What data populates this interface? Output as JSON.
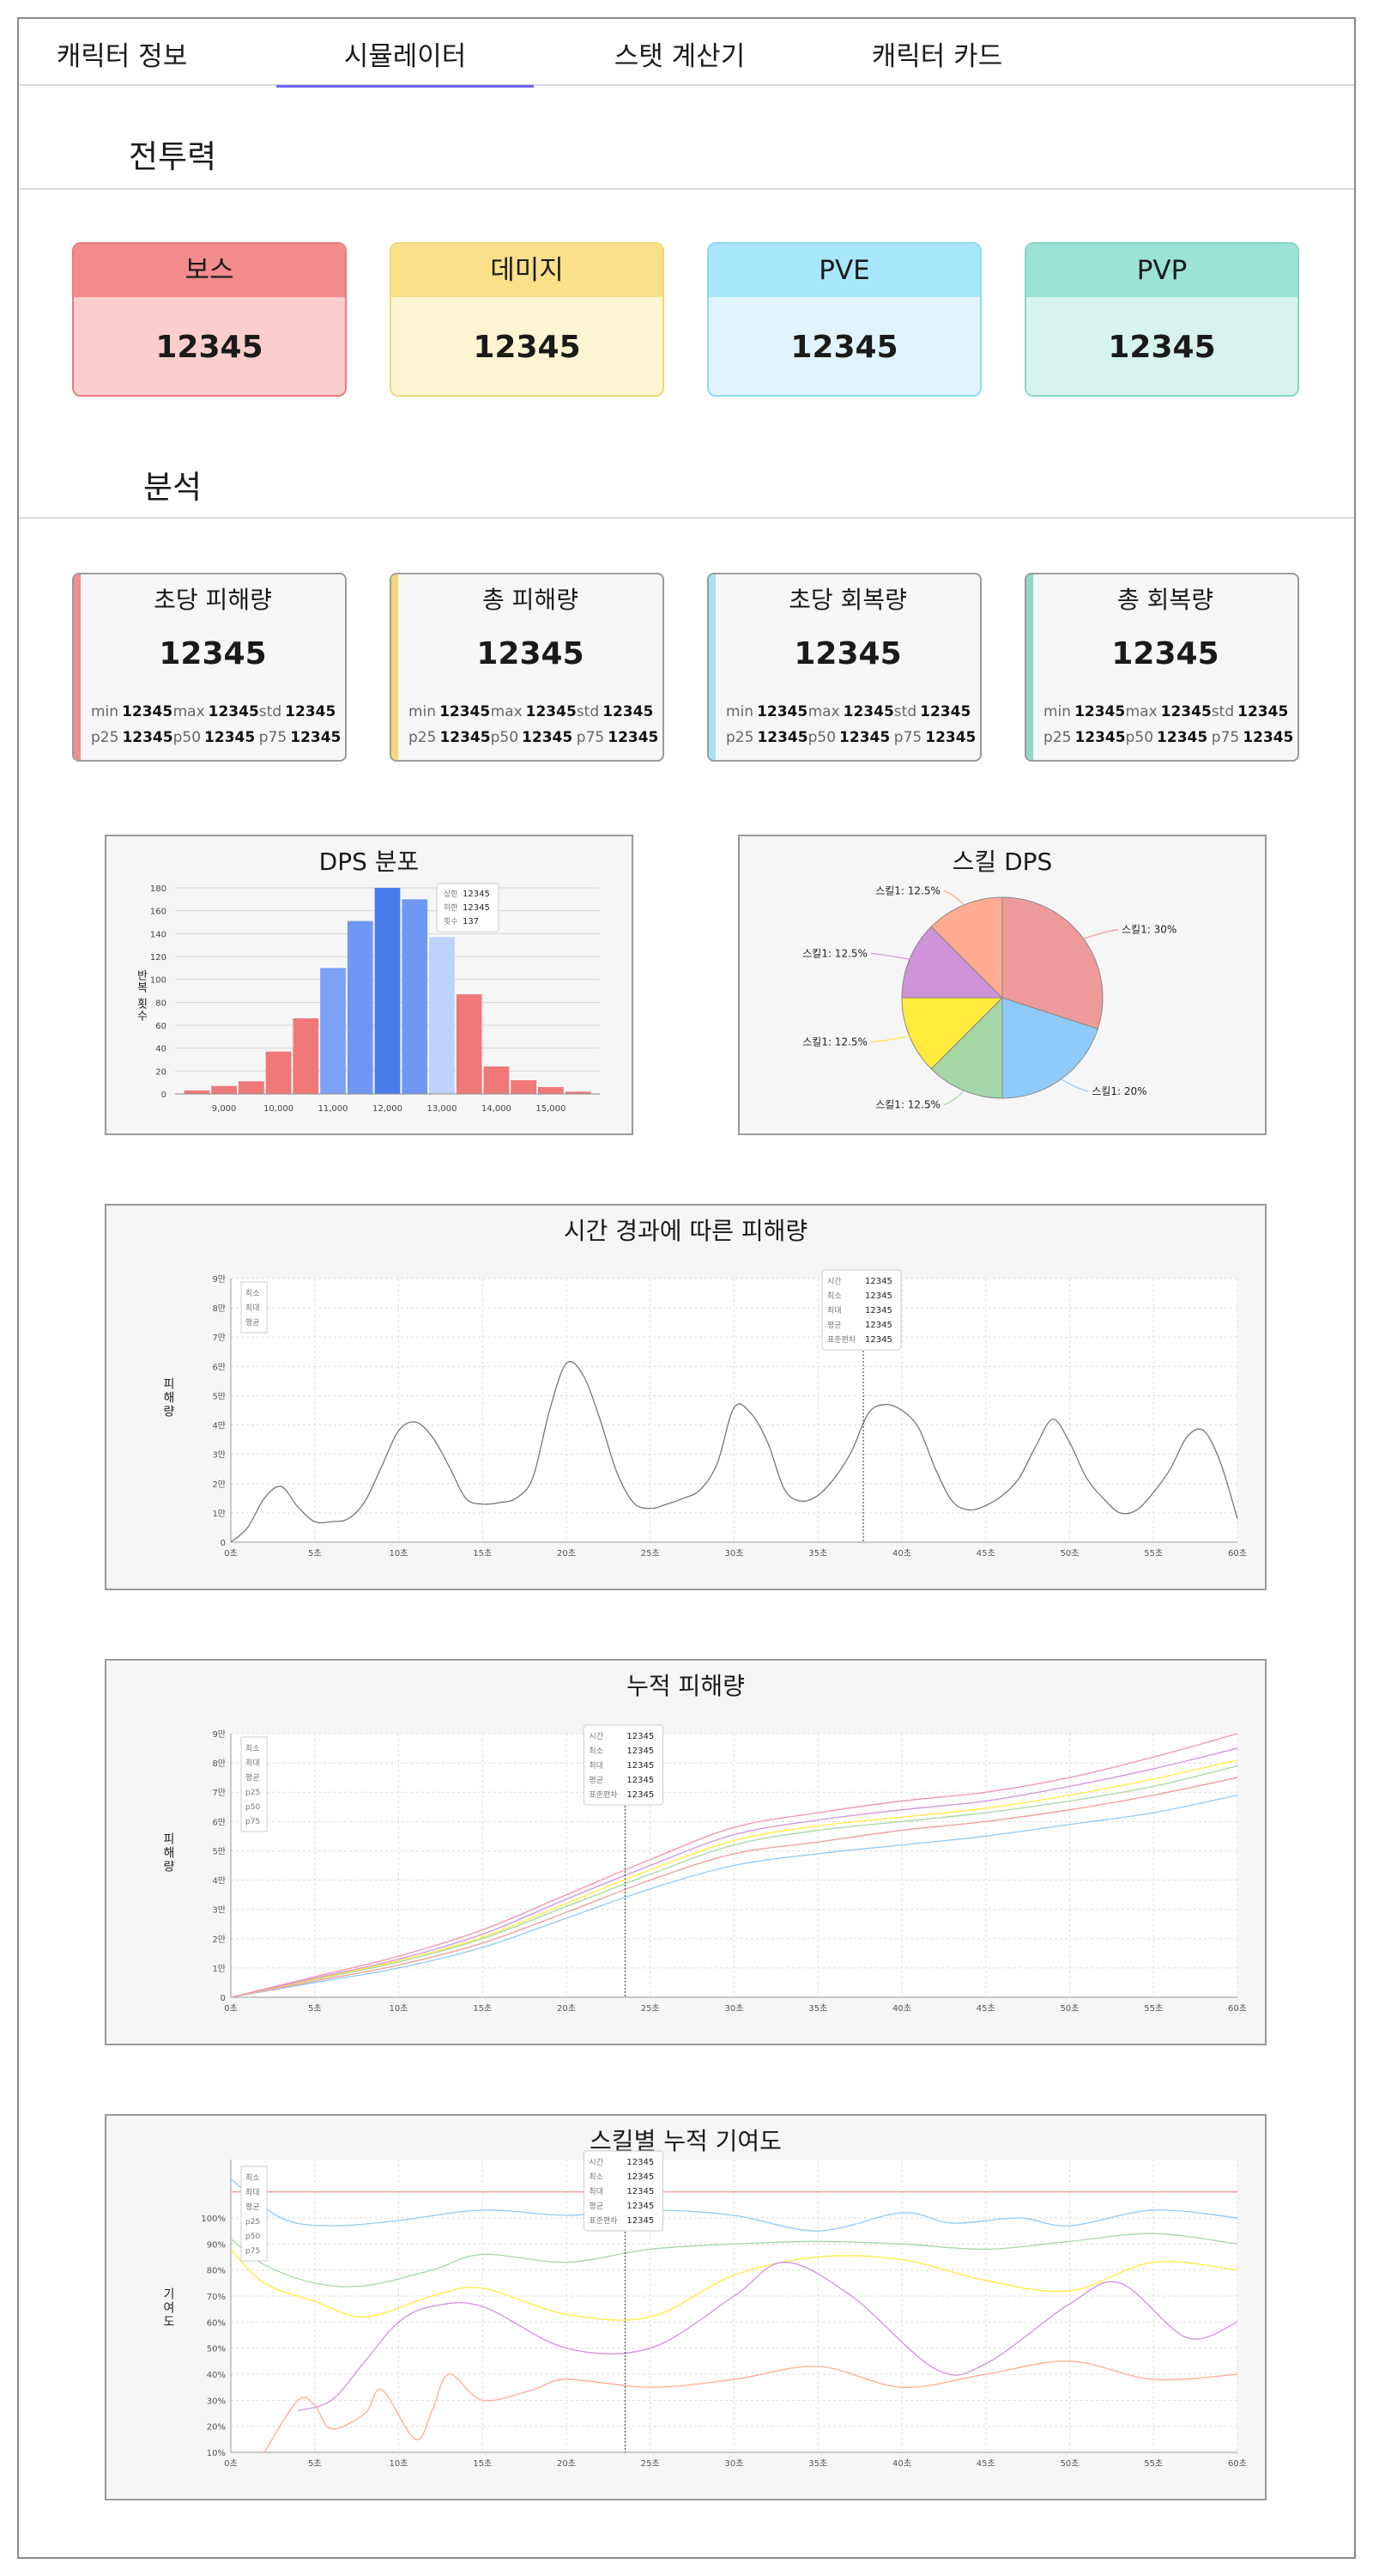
{
  "tabs": [
    {
      "label": "캐릭터 정보"
    },
    {
      "label": "시뮬레이터"
    },
    {
      "label": "스탯 계산기"
    },
    {
      "label": "캐릭터 카드"
    }
  ],
  "sections": {
    "power": "전투력",
    "analysis": "분석"
  },
  "power_cards": [
    {
      "label": "보스",
      "value": "12345",
      "head": "#f28b8b",
      "body": "#facece",
      "border": "#e87a7a"
    },
    {
      "label": "데미지",
      "value": "12345",
      "head": "#fbe08a",
      "body": "#fdf4d2",
      "border": "#f2d674"
    },
    {
      "label": "PVE",
      "value": "12345",
      "head": "#a8e6fb",
      "body": "#dff4fc",
      "border": "#8fd9f2"
    },
    {
      "label": "PVP",
      "value": "12345",
      "head": "#9ae3d5",
      "body": "#d6f3ed",
      "border": "#86d6c6"
    }
  ],
  "stat_cards": [
    {
      "title": "초당 피해량",
      "value": "12345",
      "accent": "#f08e8e",
      "min": "12345",
      "max": "12345",
      "std": "12345",
      "p25": "12345",
      "p50": "12345",
      "p75": "12345"
    },
    {
      "title": "총 피해량",
      "value": "12345",
      "accent": "#f6d879",
      "min": "12345",
      "max": "12345",
      "std": "12345",
      "p25": "12345",
      "p50": "12345",
      "p75": "12345"
    },
    {
      "title": "초당 회복량",
      "value": "12345",
      "accent": "#a8e0f6",
      "min": "12345",
      "max": "12345",
      "std": "12345",
      "p25": "12345",
      "p50": "12345",
      "p75": "12345"
    },
    {
      "title": "총 회복량",
      "value": "12345",
      "accent": "#8fd8c7",
      "min": "12345",
      "max": "12345",
      "std": "12345",
      "p25": "12345",
      "p50": "12345",
      "p75": "12345"
    }
  ],
  "stat_labels": {
    "min": "min",
    "max": "max",
    "std": "std",
    "p25": "p25",
    "p50": "p50",
    "p75": "p75"
  },
  "chart_data": [
    {
      "type": "bar",
      "title": "DPS 분포",
      "ylabel": "반복 횟수",
      "ylim": [
        0,
        180
      ],
      "yticks": [
        0,
        20,
        40,
        60,
        80,
        100,
        120,
        140,
        160,
        180
      ],
      "xticks": [
        "9,000",
        "10,000",
        "11,000",
        "12,000",
        "13,000",
        "14,000",
        "15,000"
      ],
      "bins": [
        {
          "x0": 8250,
          "x1": 8750,
          "value": 3,
          "color": "#f07878"
        },
        {
          "x0": 8750,
          "x1": 9250,
          "value": 7,
          "color": "#f07878"
        },
        {
          "x0": 9250,
          "x1": 9750,
          "value": 11,
          "color": "#f07878"
        },
        {
          "x0": 9750,
          "x1": 10250,
          "value": 37,
          "color": "#f07878"
        },
        {
          "x0": 10250,
          "x1": 10750,
          "value": 66,
          "color": "#f07878"
        },
        {
          "x0": 10750,
          "x1": 11250,
          "value": 110,
          "color": "#7ba2f5"
        },
        {
          "x0": 11250,
          "x1": 11750,
          "value": 151,
          "color": "#6f97f3"
        },
        {
          "x0": 11750,
          "x1": 12250,
          "value": 180,
          "color": "#4a7cec"
        },
        {
          "x0": 12250,
          "x1": 12750,
          "value": 170,
          "color": "#6f97f3"
        },
        {
          "x0": 12750,
          "x1": 13250,
          "value": 137,
          "color": "#bcd2fb"
        },
        {
          "x0": 13250,
          "x1": 13750,
          "value": 87,
          "color": "#f07878"
        },
        {
          "x0": 13750,
          "x1": 14250,
          "value": 24,
          "color": "#f07878"
        },
        {
          "x0": 14250,
          "x1": 14750,
          "value": 12,
          "color": "#f07878"
        },
        {
          "x0": 14750,
          "x1": 15250,
          "value": 6,
          "color": "#f07878"
        },
        {
          "x0": 15250,
          "x1": 15750,
          "value": 2,
          "color": "#f07878"
        }
      ],
      "tooltip": [
        [
          "상한",
          "12345"
        ],
        [
          "하한",
          "12345"
        ],
        [
          "횟수",
          "137"
        ]
      ]
    },
    {
      "type": "pie",
      "title": "스킬 DPS",
      "slices": [
        {
          "label": "스킬1: 30%",
          "value": 30,
          "color": "#ef9a9a"
        },
        {
          "label": "스킬1: 20%",
          "value": 20,
          "color": "#90caf9"
        },
        {
          "label": "스킬1: 12.5%",
          "value": 12.5,
          "color": "#a5d6a7"
        },
        {
          "label": "스킬1: 12.5%",
          "value": 12.5,
          "color": "#ffeb3b"
        },
        {
          "label": "스킬1: 12.5%",
          "value": 12.5,
          "color": "#ce93d8"
        },
        {
          "label": "스킬1: 12.5%",
          "value": 12.5,
          "color": "#ffab91"
        }
      ]
    },
    {
      "type": "line",
      "title": "시간 경과에 따른 피해량",
      "ylabel": "피해량",
      "xlim": [
        0,
        60
      ],
      "ylim": [
        0,
        9
      ],
      "xticks": [
        "0초",
        "5초",
        "10초",
        "15초",
        "20초",
        "25초",
        "30초",
        "35초",
        "40초",
        "45초",
        "50초",
        "55초",
        "60초"
      ],
      "yticks": [
        "0",
        "1만",
        "2만",
        "3만",
        "4만",
        "5만",
        "6만",
        "7만",
        "8만",
        "9만"
      ],
      "legend": [
        "최소",
        "최대",
        "평균"
      ],
      "series": [
        {
          "color": "#777777",
          "x": [
            0,
            1,
            2,
            3,
            4,
            5,
            6,
            7,
            8,
            9,
            10,
            11,
            12,
            13,
            14,
            15,
            16,
            17,
            18,
            19,
            20,
            21,
            22,
            23,
            24,
            25,
            26,
            27,
            28,
            29,
            30,
            31,
            32,
            33,
            34,
            35,
            36,
            37,
            38,
            39,
            40,
            41,
            42,
            43,
            44,
            45,
            46,
            47,
            48,
            49,
            50,
            51,
            52,
            53,
            54,
            55,
            56,
            57,
            58,
            59,
            60
          ],
          "y": [
            0,
            0.5,
            1.5,
            1.9,
            1.2,
            0.7,
            0.7,
            0.8,
            1.4,
            2.6,
            3.8,
            4.1,
            3.6,
            2.6,
            1.5,
            1.3,
            1.35,
            1.5,
            2.2,
            4.5,
            6.1,
            5.7,
            4.2,
            2.4,
            1.35,
            1.15,
            1.3,
            1.5,
            1.8,
            2.7,
            4.6,
            4.4,
            3.4,
            1.8,
            1.4,
            1.6,
            2.2,
            3.1,
            4.4,
            4.7,
            4.5,
            3.9,
            2.5,
            1.4,
            1.1,
            1.25,
            1.6,
            2.2,
            3.3,
            4.2,
            3.4,
            2.2,
            1.5,
            1.0,
            1.1,
            1.7,
            2.5,
            3.6,
            3.8,
            2.7,
            0.8
          ]
        }
      ],
      "cursor_x": 37.7,
      "tooltip": [
        [
          "시간",
          "12345"
        ],
        [
          "최소",
          "12345"
        ],
        [
          "최대",
          "12345"
        ],
        [
          "평균",
          "12345"
        ],
        [
          "표준편차",
          "12345"
        ]
      ]
    },
    {
      "type": "line",
      "title": "누적 피해량",
      "ylabel": "피해량",
      "xlim": [
        0,
        60
      ],
      "ylim": [
        0,
        9
      ],
      "xticks": [
        "0초",
        "5초",
        "10초",
        "15초",
        "20초",
        "25초",
        "30초",
        "35초",
        "40초",
        "45초",
        "50초",
        "55초",
        "60초"
      ],
      "yticks": [
        "0",
        "1만",
        "2만",
        "3만",
        "4만",
        "5만",
        "6만",
        "7만",
        "8만",
        "9만"
      ],
      "legend": [
        "최소",
        "최대",
        "평균",
        "p25",
        "p50",
        "p75"
      ],
      "series": [
        {
          "color": "#90caf9",
          "x": [
            0,
            5,
            10,
            15,
            20,
            25,
            30,
            35,
            40,
            45,
            50,
            55,
            60
          ],
          "y": [
            0,
            0.5,
            1.0,
            1.7,
            2.7,
            3.7,
            4.5,
            4.9,
            5.2,
            5.5,
            5.9,
            6.3,
            6.9
          ]
        },
        {
          "color": "#ef9a9a",
          "x": [
            0,
            5,
            10,
            15,
            20,
            25,
            30,
            35,
            40,
            45,
            50,
            55,
            60
          ],
          "y": [
            0,
            0.55,
            1.1,
            1.85,
            2.9,
            4.0,
            4.9,
            5.3,
            5.7,
            6.0,
            6.4,
            6.9,
            7.5
          ]
        },
        {
          "color": "#a5d6a7",
          "x": [
            0,
            5,
            10,
            15,
            20,
            25,
            30,
            35,
            40,
            45,
            50,
            55,
            60
          ],
          "y": [
            0,
            0.6,
            1.2,
            2.0,
            3.1,
            4.2,
            5.2,
            5.7,
            6.0,
            6.3,
            6.7,
            7.2,
            7.9
          ]
        },
        {
          "color": "#ffeb3b",
          "x": [
            0,
            5,
            10,
            15,
            20,
            25,
            30,
            35,
            40,
            45,
            50,
            55,
            60
          ],
          "y": [
            0,
            0.62,
            1.25,
            2.05,
            3.2,
            4.35,
            5.35,
            5.85,
            6.15,
            6.45,
            6.9,
            7.45,
            8.1
          ]
        },
        {
          "color": "#ce93d8",
          "x": [
            0,
            5,
            10,
            15,
            20,
            25,
            30,
            35,
            40,
            45,
            50,
            55,
            60
          ],
          "y": [
            0,
            0.65,
            1.3,
            2.15,
            3.35,
            4.5,
            5.55,
            6.05,
            6.4,
            6.7,
            7.2,
            7.8,
            8.5
          ]
        },
        {
          "color": "#f48fb1",
          "x": [
            0,
            5,
            10,
            15,
            20,
            25,
            30,
            35,
            40,
            45,
            50,
            55,
            60
          ],
          "y": [
            0,
            0.7,
            1.4,
            2.3,
            3.5,
            4.7,
            5.8,
            6.3,
            6.7,
            7.0,
            7.5,
            8.2,
            9.0
          ]
        }
      ],
      "cursor_x": 23.5,
      "tooltip": [
        [
          "시간",
          "12345"
        ],
        [
          "최소",
          "12345"
        ],
        [
          "최대",
          "12345"
        ],
        [
          "평균",
          "12345"
        ],
        [
          "표준편차",
          "12345"
        ]
      ]
    },
    {
      "type": "line",
      "title": "스킬별 누적 기여도",
      "ylabel": "기여도",
      "xlim": [
        0,
        60
      ],
      "ylim": [
        10,
        100
      ],
      "ylim_top": 110,
      "xticks": [
        "0초",
        "5초",
        "10초",
        "15초",
        "20초",
        "25초",
        "30초",
        "35초",
        "40초",
        "45초",
        "50초",
        "55초",
        "60초"
      ],
      "yticks": [
        "10%",
        "20%",
        "30%",
        "40%",
        "50%",
        "60%",
        "70%",
        "80%",
        "90%",
        "100%"
      ],
      "legend": [
        "최소",
        "최대",
        "평균",
        "p25",
        "p50",
        "p75"
      ],
      "series": [
        {
          "color": "#ef9a9a",
          "x": [
            0,
            5,
            10,
            15,
            20,
            25,
            30,
            35,
            40,
            45,
            50,
            55,
            60
          ],
          "y": [
            110,
            110,
            110,
            110,
            110,
            110,
            110,
            110,
            110,
            110,
            110,
            110,
            110
          ]
        },
        {
          "color": "#90caf9",
          "x": [
            0,
            3,
            6,
            10,
            15,
            20,
            25,
            30,
            35,
            40,
            43,
            47,
            50,
            55,
            60
          ],
          "y": [
            115,
            100,
            97,
            99,
            103,
            101,
            103,
            101,
            95,
            102,
            98,
            100,
            97,
            103,
            100
          ]
        },
        {
          "color": "#a5d6a7",
          "x": [
            0,
            2,
            5,
            8,
            12,
            15,
            20,
            25,
            30,
            35,
            40,
            45,
            50,
            55,
            60
          ],
          "y": [
            92,
            82,
            75,
            74,
            80,
            86,
            83,
            88,
            90,
            91,
            90,
            88,
            91,
            94,
            90
          ]
        },
        {
          "color": "#ffeb3b",
          "x": [
            0,
            2,
            5,
            8,
            12,
            15,
            20,
            25,
            30,
            35,
            40,
            45,
            50,
            55,
            60
          ],
          "y": [
            88,
            75,
            68,
            62,
            70,
            73,
            63,
            62,
            78,
            85,
            84,
            76,
            72,
            83,
            80
          ]
        },
        {
          "color": "#ce93d8",
          "x": [
            4,
            6,
            8,
            10,
            12,
            15,
            20,
            25,
            30,
            33,
            37,
            42,
            45,
            50,
            53,
            57,
            60
          ],
          "y": [
            26,
            30,
            45,
            60,
            66,
            66,
            50,
            50,
            70,
            83,
            70,
            42,
            44,
            67,
            75,
            54,
            60
          ]
        },
        {
          "color": "#ffab91",
          "x": [
            2,
            4,
            5,
            6,
            8,
            9,
            11,
            12,
            13,
            15,
            18,
            20,
            25,
            30,
            35,
            40,
            45,
            50,
            55,
            60
          ],
          "y": [
            10,
            30,
            28,
            19,
            25,
            34,
            15,
            26,
            40,
            30,
            34,
            38,
            35,
            38,
            43,
            35,
            40,
            45,
            38,
            40
          ]
        }
      ],
      "cursor_x": 23.5,
      "tooltip": [
        [
          "시간",
          "12345"
        ],
        [
          "최소",
          "12345"
        ],
        [
          "최대",
          "12345"
        ],
        [
          "평균",
          "12345"
        ],
        [
          "표준편차",
          "12345"
        ]
      ]
    }
  ]
}
